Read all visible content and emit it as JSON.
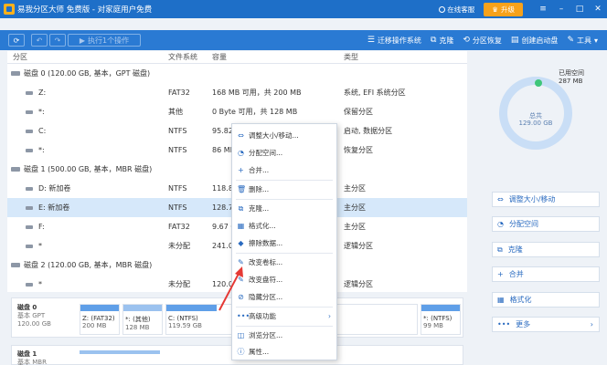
{
  "app": {
    "title": "易我分区大师 免费版 - 对家庭用户免费",
    "online_help": "在线客服",
    "upgrade": "升级",
    "window_controls": [
      "≡",
      "–",
      "□",
      "✕"
    ]
  },
  "toolbar": {
    "refresh": "⟳",
    "undo": "↶",
    "redo": "↷",
    "execute_label": "执行1个操作",
    "items": [
      {
        "label": "迁移操作系统",
        "icon": "☰"
      },
      {
        "label": "克隆",
        "icon": "⧉"
      },
      {
        "label": "分区恢复",
        "icon": "⟲"
      },
      {
        "label": "创建启动盘",
        "icon": "▤"
      },
      {
        "label": "工具",
        "icon": "✎"
      }
    ]
  },
  "table": {
    "headers": [
      "分区",
      "文件系统",
      "容量",
      "类型"
    ],
    "rows": [
      {
        "kind": "disk",
        "name": "磁盘 0 (120.00 GB, 基本，GPT 磁盘)",
        "fs": "",
        "cap": "",
        "type": ""
      },
      {
        "kind": "part",
        "name": "Z:",
        "fs": "FAT32",
        "cap": "168 MB   可用，共  200 MB",
        "type": "系统, EFI 系统分区"
      },
      {
        "kind": "part",
        "name": "*:",
        "fs": "其他",
        "cap": "0 Byte   可用，共  128 MB",
        "type": "保留分区"
      },
      {
        "kind": "part",
        "name": "C:",
        "fs": "NTFS",
        "cap": "95.82",
        "type": "启动, 数据分区"
      },
      {
        "kind": "part",
        "name": "*:",
        "fs": "NTFS",
        "cap": "86 MI",
        "type": "恢复分区"
      },
      {
        "kind": "disk",
        "name": "磁盘 1 (500.00 GB, 基本，MBR 磁盘)",
        "fs": "",
        "cap": "",
        "type": ""
      },
      {
        "kind": "part",
        "name": "D: 新加卷",
        "fs": "NTFS",
        "cap": "118.8",
        "type": "主分区"
      },
      {
        "kind": "part",
        "name": "E: 新加卷",
        "fs": "NTFS",
        "cap": "128.7",
        "type": "主分区",
        "selected": true
      },
      {
        "kind": "part",
        "name": "F:",
        "fs": "FAT32",
        "cap": "9.67 G",
        "type": "主分区"
      },
      {
        "kind": "part",
        "name": "*",
        "fs": "未分配",
        "cap": "241.0",
        "type": "逻辑分区"
      },
      {
        "kind": "disk",
        "name": "磁盘 2 (120.00 GB, 基本，MBR 磁盘)",
        "fs": "",
        "cap": "",
        "type": ""
      },
      {
        "kind": "part",
        "name": "*",
        "fs": "未分配",
        "cap": "120.0",
        "type": "逻辑分区"
      }
    ]
  },
  "disk_map": {
    "disk0": {
      "name": "磁盘 0",
      "type": "基本 GPT",
      "size": "120.00 GB",
      "segments": [
        {
          "label": "Z: (FAT32)",
          "size": "200 MB"
        },
        {
          "label": "*: (其他)",
          "size": "128 MB"
        },
        {
          "label": "C: (NTFS)",
          "size": "119.59 GB"
        },
        {
          "label": "*: (NTFS)",
          "size": "99 MB"
        }
      ]
    },
    "disk1": {
      "name": "磁盘 1",
      "type": "基本 MBR"
    }
  },
  "right_panel": {
    "used_label": "已用空间",
    "used_value": "287 MB",
    "total_label": "总共",
    "total_value": "129.00 GB",
    "actions": [
      {
        "label": "调整大小/移动",
        "icon": "⇔"
      },
      {
        "label": "分配空间",
        "icon": "◔"
      },
      {
        "label": "克隆",
        "icon": "⧉"
      },
      {
        "label": "合并",
        "icon": "+"
      },
      {
        "label": "格式化",
        "icon": "▦"
      },
      {
        "label": "更多",
        "icon": "•••",
        "arrow": "›"
      }
    ]
  },
  "context_menu": {
    "items": [
      {
        "label": "调整大小/移动...",
        "icon": "⇔"
      },
      {
        "label": "分配空间...",
        "icon": "◔"
      },
      {
        "label": "合并...",
        "icon": "+"
      },
      {
        "label": "删除...",
        "icon": "🗑"
      },
      {
        "label": "克隆...",
        "icon": "⧉"
      },
      {
        "label": "格式化...",
        "icon": "▦"
      },
      {
        "label": "擦除数据...",
        "icon": "◆"
      },
      {
        "label": "改变卷标...",
        "icon": "✎"
      },
      {
        "label": "改变盘符...",
        "icon": "✎"
      },
      {
        "label": "隐藏分区...",
        "icon": "⊘"
      },
      {
        "label": "高级功能",
        "icon": "•••",
        "arrow": "›"
      },
      {
        "label": "浏览分区...",
        "icon": "◫"
      },
      {
        "label": "属性...",
        "icon": "ⓘ"
      }
    ]
  },
  "colors": {
    "titlebar": "#1e6fc8",
    "toolbar": "#2a7ad3",
    "accent": "#2a6bc0",
    "selected_row": "#d6e8fa",
    "upgrade": "#f7a21b",
    "annotation_arrow": "#e53935",
    "used_dot": "#3fc67a"
  }
}
